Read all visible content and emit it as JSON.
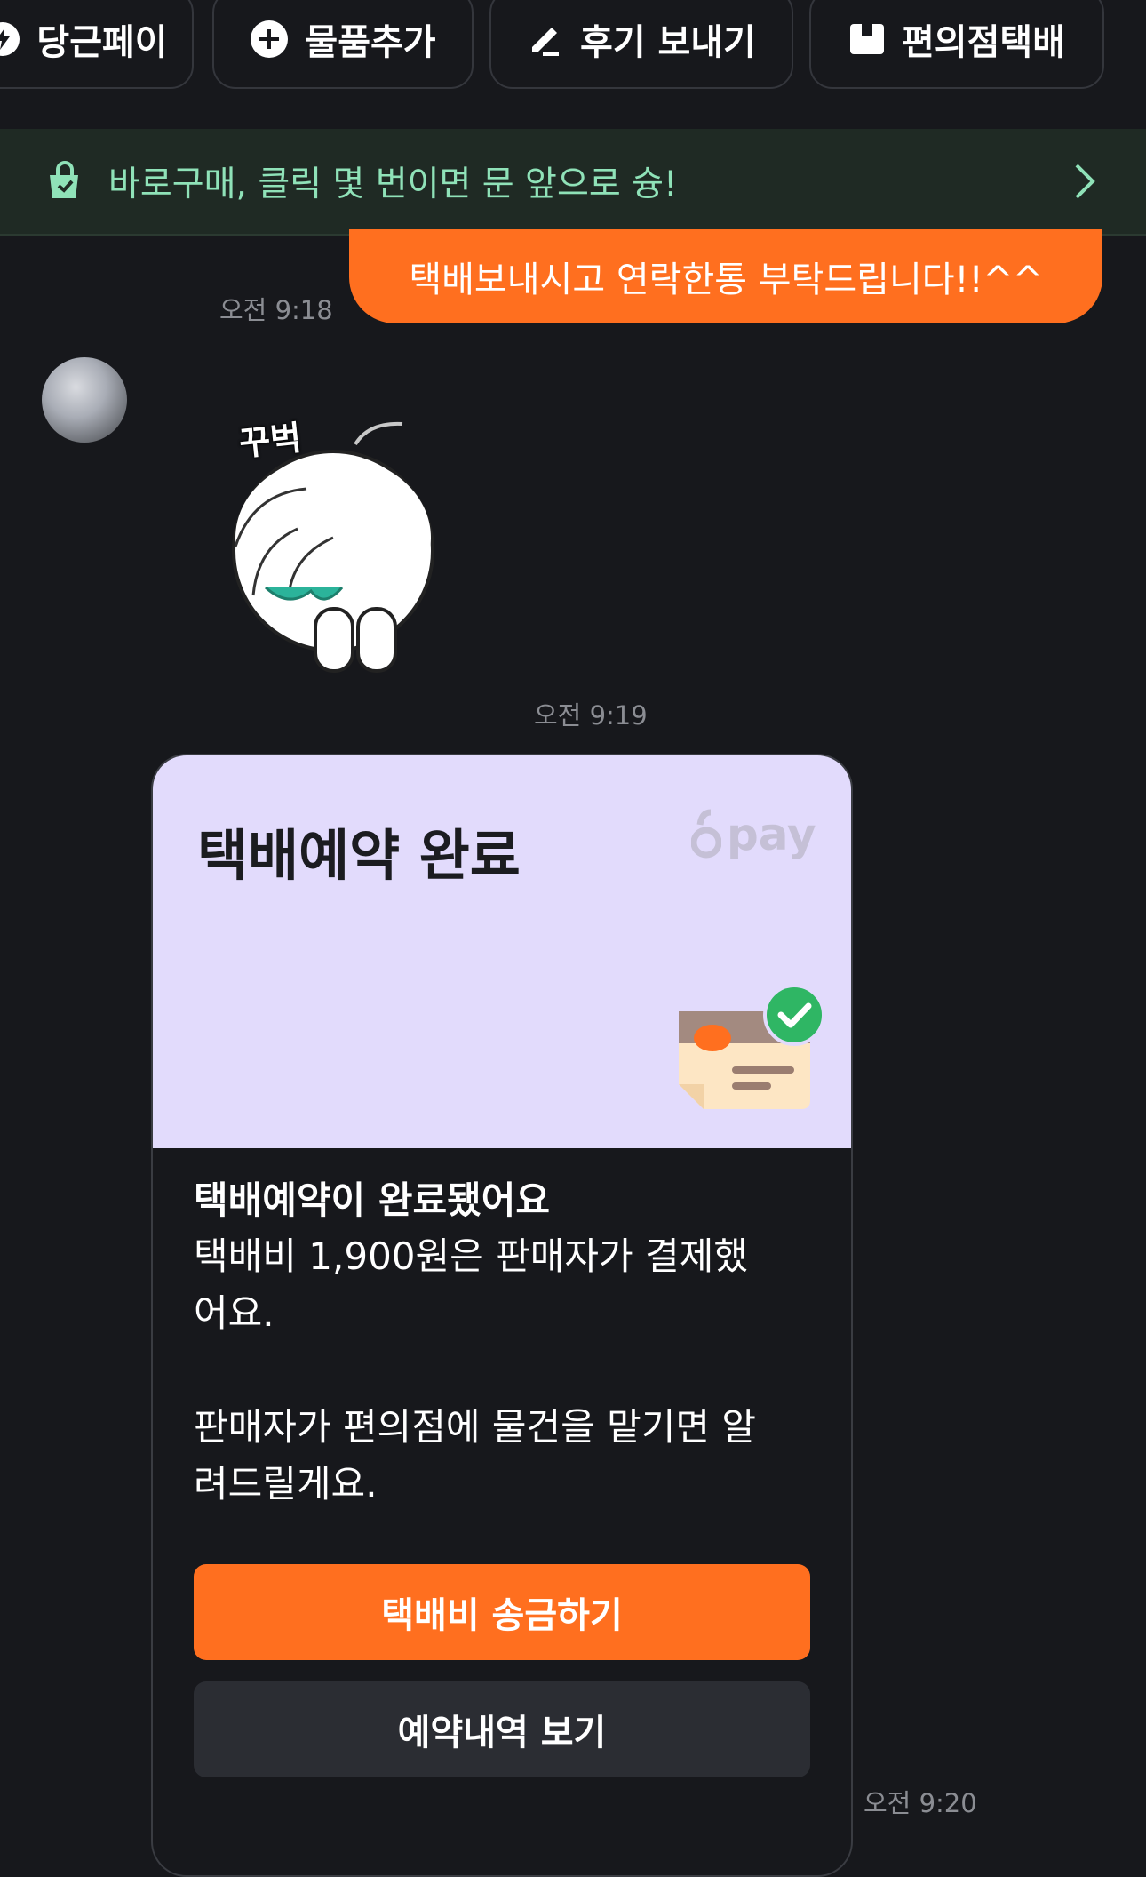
{
  "toolbar": {
    "chips": [
      {
        "label": "당근페이",
        "icon": "daangn-pay-icon"
      },
      {
        "label": "물품추가",
        "icon": "plus-circle-icon"
      },
      {
        "label": "후기 보내기",
        "icon": "pencil-icon"
      },
      {
        "label": "편의점택배",
        "icon": "box-icon"
      }
    ]
  },
  "banner": {
    "text": "바로구매, 클릭 몇 번이면 문 앞으로 슝!",
    "icon": "shopping-bag-icon",
    "arrow_icon": "chevron-right-icon"
  },
  "messages": [
    {
      "sender": "me",
      "text": "택배보내시고 연락한통 부탁드립니다!!^^",
      "time": "오전 9:18"
    },
    {
      "sender": "other",
      "type": "sticker",
      "sticker_text": "꾸벅",
      "time": "오전 9:19"
    },
    {
      "sender": "other",
      "type": "card",
      "time": "오전 9:20"
    }
  ],
  "card": {
    "title": "택배예약 완료",
    "brand": "pay",
    "body_title": "택배예약이 완료됐어요",
    "body_line1a": "택배비 1,900원은 판매자가 결제했",
    "body_line1b": "어요.",
    "body_line2a": "판매자가 편의점에 물건을 맡기면 알",
    "body_line2b": "려드릴게요.",
    "primary_button": "택배비 송금하기",
    "secondary_button": "예약내역 보기"
  },
  "colors": {
    "background": "#17181c",
    "accent": "#ff6f1f",
    "banner_text": "#8fe2b8",
    "card_header": "#e2dbfc",
    "secondary_button": "#2b2d33"
  }
}
